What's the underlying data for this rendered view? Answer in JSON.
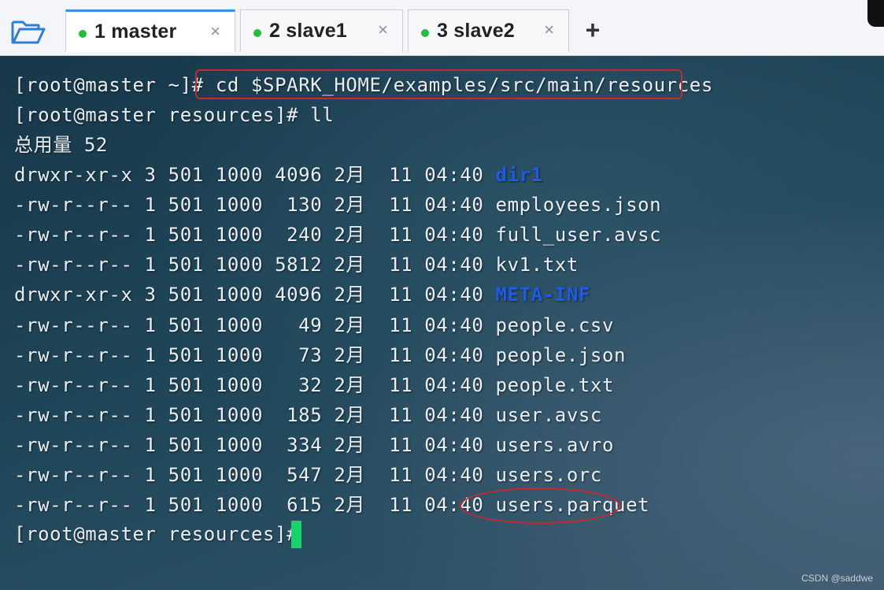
{
  "tabs": [
    {
      "label": "1 master",
      "active": true
    },
    {
      "label": "2 slave1",
      "active": false
    },
    {
      "label": "3 slave2",
      "active": false
    }
  ],
  "tab_close_glyph": "×",
  "new_tab_glyph": "+",
  "terminal": {
    "prompt1": "[root@master ~]# ",
    "command1": "cd $SPARK_HOME/examples/src/main/resources",
    "prompt2": "[root@master resources]# ll",
    "total": "总用量 52",
    "entries": [
      {
        "prefix": "drwxr-xr-x 3 501 1000 4096 2月  11 04:40 ",
        "name": "dir1",
        "is_dir": true
      },
      {
        "prefix": "-rw-r--r-- 1 501 1000  130 2月  11 04:40 ",
        "name": "employees.json",
        "is_dir": false
      },
      {
        "prefix": "-rw-r--r-- 1 501 1000  240 2月  11 04:40 ",
        "name": "full_user.avsc",
        "is_dir": false
      },
      {
        "prefix": "-rw-r--r-- 1 501 1000 5812 2月  11 04:40 ",
        "name": "kv1.txt",
        "is_dir": false
      },
      {
        "prefix": "drwxr-xr-x 3 501 1000 4096 2月  11 04:40 ",
        "name": "META-INF",
        "is_dir": true
      },
      {
        "prefix": "-rw-r--r-- 1 501 1000   49 2月  11 04:40 ",
        "name": "people.csv",
        "is_dir": false
      },
      {
        "prefix": "-rw-r--r-- 1 501 1000   73 2月  11 04:40 ",
        "name": "people.json",
        "is_dir": false
      },
      {
        "prefix": "-rw-r--r-- 1 501 1000   32 2月  11 04:40 ",
        "name": "people.txt",
        "is_dir": false
      },
      {
        "prefix": "-rw-r--r-- 1 501 1000  185 2月  11 04:40 ",
        "name": "user.avsc",
        "is_dir": false
      },
      {
        "prefix": "-rw-r--r-- 1 501 1000  334 2月  11 04:40 ",
        "name": "users.avro",
        "is_dir": false
      },
      {
        "prefix": "-rw-r--r-- 1 501 1000  547 2月  11 04:40 ",
        "name": "users.orc",
        "is_dir": false
      },
      {
        "prefix": "-rw-r--r-- 1 501 1000  615 2月  11 04:40 ",
        "name": "users.parquet",
        "is_dir": false
      }
    ],
    "prompt3": "[root@master resources]# "
  },
  "watermark": "CSDN @saddwe",
  "colors": {
    "directory": "#1d5be8",
    "annotation": "#c9282d",
    "cursor": "#18d36a",
    "tab_dot": "#1fbf3b",
    "active_tab_accent": "#3c8ee8"
  },
  "icons": {
    "folder": "folder-open-icon",
    "close": "close-icon",
    "add": "plus-icon"
  }
}
